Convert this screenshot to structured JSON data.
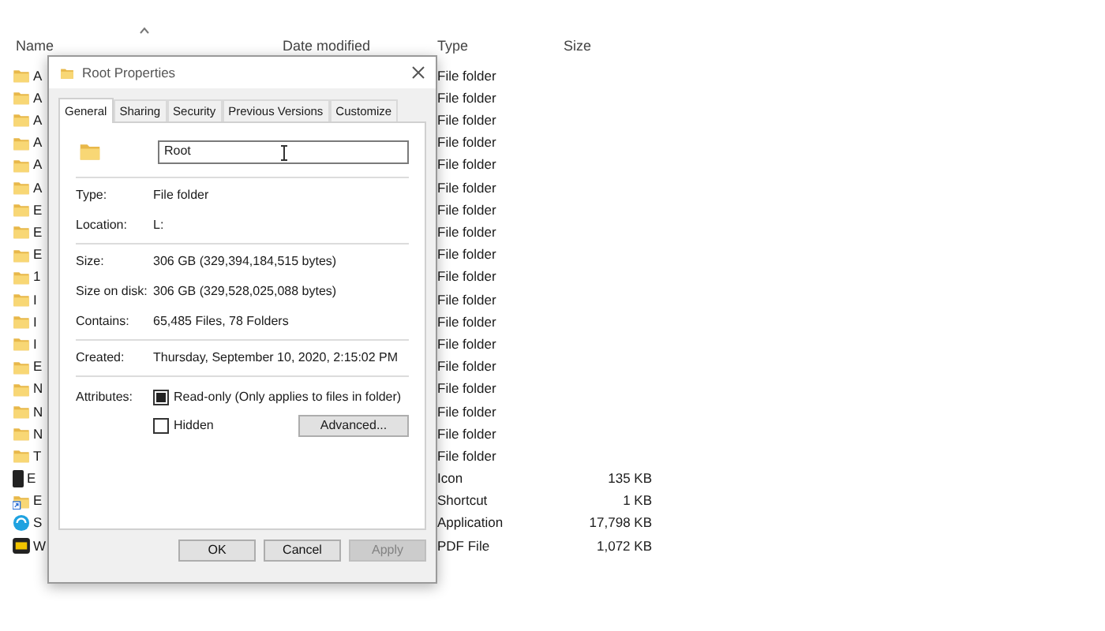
{
  "explorer": {
    "columns": [
      {
        "label": "Name",
        "sorted": true
      },
      {
        "label": "Date modified"
      },
      {
        "label": "Type"
      },
      {
        "label": "Size"
      }
    ],
    "rows": [
      {
        "kind": "folder",
        "name": "A",
        "type": "File folder"
      },
      {
        "kind": "folder",
        "name": "A",
        "type": "File folder"
      },
      {
        "kind": "folder",
        "name": "A",
        "type": "File folder"
      },
      {
        "kind": "folder",
        "name": "A",
        "type": "File folder"
      },
      {
        "kind": "folder",
        "name": "A",
        "type": "File folder"
      },
      {
        "kind": "folder",
        "name": "A",
        "type": "File folder"
      },
      {
        "kind": "folder",
        "name": "E",
        "type": "File folder"
      },
      {
        "kind": "folder",
        "name": "E",
        "type": "File folder"
      },
      {
        "kind": "folder",
        "name": "E",
        "type": "File folder"
      },
      {
        "kind": "folder",
        "name": "1",
        "type": "File folder"
      },
      {
        "kind": "folder",
        "name": "I",
        "type": "File folder"
      },
      {
        "kind": "folder",
        "name": "I",
        "type": "File folder"
      },
      {
        "kind": "folder",
        "name": "I",
        "type": "File folder"
      },
      {
        "kind": "folder",
        "name": "E",
        "type": "File folder"
      },
      {
        "kind": "folder",
        "name": "N",
        "type": "File folder"
      },
      {
        "kind": "folder",
        "name": "N",
        "type": "File folder"
      },
      {
        "kind": "folder",
        "name": "N",
        "type": "File folder"
      },
      {
        "kind": "folder",
        "name": "T",
        "type": "File folder"
      },
      {
        "kind": "device",
        "name": "E",
        "type": "Icon",
        "size": "135 KB"
      },
      {
        "kind": "shortcut",
        "name": "E",
        "type": "Shortcut",
        "size": "1 KB"
      },
      {
        "kind": "app",
        "name": "S",
        "type": "Application",
        "size": "17,798 KB"
      },
      {
        "kind": "pdf",
        "name": "W",
        "type": "PDF File",
        "size": "1,072 KB"
      }
    ]
  },
  "dialog": {
    "title": "Root Properties",
    "tabs": [
      {
        "label": "General",
        "selected": true
      },
      {
        "label": "Sharing",
        "selected": false
      },
      {
        "label": "Security",
        "selected": false
      },
      {
        "label": "Previous Versions",
        "selected": false
      },
      {
        "label": "Customize",
        "selected": false
      }
    ],
    "name_value": "Root",
    "groups": [
      [
        {
          "label": "Type:",
          "value": "File folder"
        },
        {
          "label": "Location:",
          "value": "L:"
        }
      ],
      [
        {
          "label": "Size:",
          "value": "306 GB (329,394,184,515 bytes)"
        },
        {
          "label": "Size on disk:",
          "value": "306 GB (329,528,025,088 bytes)"
        },
        {
          "label": "Contains:",
          "value": "65,485 Files, 78 Folders"
        }
      ],
      [
        {
          "label": "Created:",
          "value": "Thursday, September 10, 2020, 2:15:02 PM"
        }
      ]
    ],
    "attributes_label": "Attributes:",
    "attributes": [
      {
        "label": "Read-only (Only applies to files in folder)",
        "checked": true
      },
      {
        "label": "Hidden",
        "checked": false
      }
    ],
    "advanced_button": "Advanced...",
    "buttons": [
      {
        "label": "OK",
        "disabled": false
      },
      {
        "label": "Cancel",
        "disabled": false
      },
      {
        "label": "Apply",
        "disabled": true
      }
    ]
  }
}
